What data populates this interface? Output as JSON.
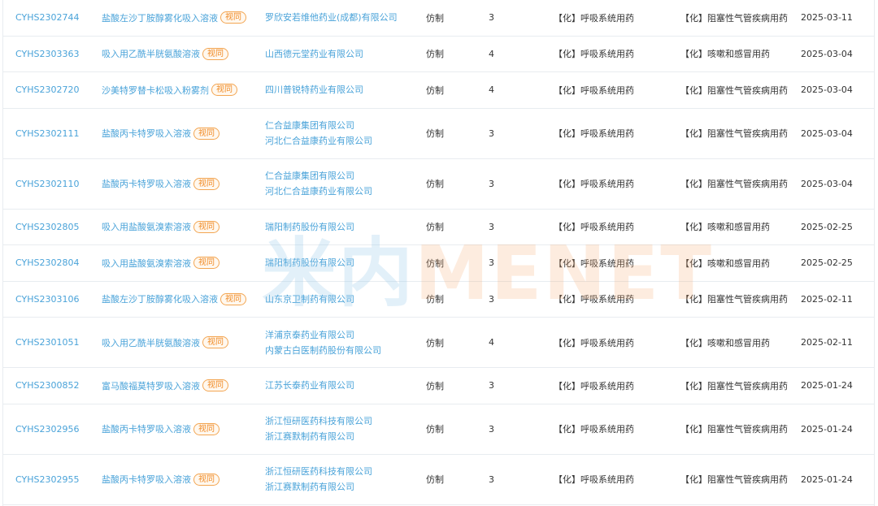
{
  "tag_label": "视同",
  "watermark": {
    "part_a": "米内",
    "part_b": "MENET"
  },
  "rows": [
    {
      "code": "CYHS2302744",
      "name": "盐酸左沙丁胺醇雾化吸入溶液",
      "company": [
        "罗欣安若维他药业(成都)有限公司"
      ],
      "type": "仿制",
      "category": "3",
      "class1": "【化】呼吸系统用药",
      "class2": "【化】阻塞性气管疾病用药",
      "date": "2025-03-11"
    },
    {
      "code": "CYHS2303363",
      "name": "吸入用乙酰半胱氨酸溶液",
      "company": [
        "山西德元堂药业有限公司"
      ],
      "type": "仿制",
      "category": "4",
      "class1": "【化】呼吸系统用药",
      "class2": "【化】咳嗽和感冒用药",
      "date": "2025-03-04"
    },
    {
      "code": "CYHS2302720",
      "name": "沙美特罗替卡松吸入粉雾剂",
      "company": [
        "四川普锐特药业有限公司"
      ],
      "type": "仿制",
      "category": "4",
      "class1": "【化】呼吸系统用药",
      "class2": "【化】阻塞性气管疾病用药",
      "date": "2025-03-04"
    },
    {
      "code": "CYHS2302111",
      "name": "盐酸丙卡特罗吸入溶液",
      "company": [
        "仁合益康集团有限公司",
        "河北仁合益康药业有限公司"
      ],
      "type": "仿制",
      "category": "3",
      "class1": "【化】呼吸系统用药",
      "class2": "【化】阻塞性气管疾病用药",
      "date": "2025-03-04"
    },
    {
      "code": "CYHS2302110",
      "name": "盐酸丙卡特罗吸入溶液",
      "company": [
        "仁合益康集团有限公司",
        "河北仁合益康药业有限公司"
      ],
      "type": "仿制",
      "category": "3",
      "class1": "【化】呼吸系统用药",
      "class2": "【化】阻塞性气管疾病用药",
      "date": "2025-03-04"
    },
    {
      "code": "CYHS2302805",
      "name": "吸入用盐酸氨溴索溶液",
      "company": [
        "瑞阳制药股份有限公司"
      ],
      "type": "仿制",
      "category": "3",
      "class1": "【化】呼吸系统用药",
      "class2": "【化】咳嗽和感冒用药",
      "date": "2025-02-25"
    },
    {
      "code": "CYHS2302804",
      "name": "吸入用盐酸氨溴索溶液",
      "company": [
        "瑞阳制药股份有限公司"
      ],
      "type": "仿制",
      "category": "3",
      "class1": "【化】呼吸系统用药",
      "class2": "【化】咳嗽和感冒用药",
      "date": "2025-02-25"
    },
    {
      "code": "CYHS2303106",
      "name": "盐酸左沙丁胺醇雾化吸入溶液",
      "company": [
        "山东京卫制药有限公司"
      ],
      "type": "仿制",
      "category": "3",
      "class1": "【化】呼吸系统用药",
      "class2": "【化】阻塞性气管疾病用药",
      "date": "2025-02-11"
    },
    {
      "code": "CYHS2301051",
      "name": "吸入用乙酰半胱氨酸溶液",
      "company": [
        "洋浦京泰药业有限公司",
        "内蒙古白医制药股份有限公司"
      ],
      "type": "仿制",
      "category": "4",
      "class1": "【化】呼吸系统用药",
      "class2": "【化】咳嗽和感冒用药",
      "date": "2025-02-11"
    },
    {
      "code": "CYHS2300852",
      "name": "富马酸福莫特罗吸入溶液",
      "company": [
        "江苏长泰药业有限公司"
      ],
      "type": "仿制",
      "category": "3",
      "class1": "【化】呼吸系统用药",
      "class2": "【化】阻塞性气管疾病用药",
      "date": "2025-01-24"
    },
    {
      "code": "CYHS2302956",
      "name": "盐酸丙卡特罗吸入溶液",
      "company": [
        "浙江恒研医药科技有限公司",
        "浙江赛默制药有限公司"
      ],
      "type": "仿制",
      "category": "3",
      "class1": "【化】呼吸系统用药",
      "class2": "【化】阻塞性气管疾病用药",
      "date": "2025-01-24"
    },
    {
      "code": "CYHS2302955",
      "name": "盐酸丙卡特罗吸入溶液",
      "company": [
        "浙江恒研医药科技有限公司",
        "浙江赛默制药有限公司"
      ],
      "type": "仿制",
      "category": "3",
      "class1": "【化】呼吸系统用药",
      "class2": "【化】阻塞性气管疾病用药",
      "date": "2025-01-24"
    }
  ]
}
